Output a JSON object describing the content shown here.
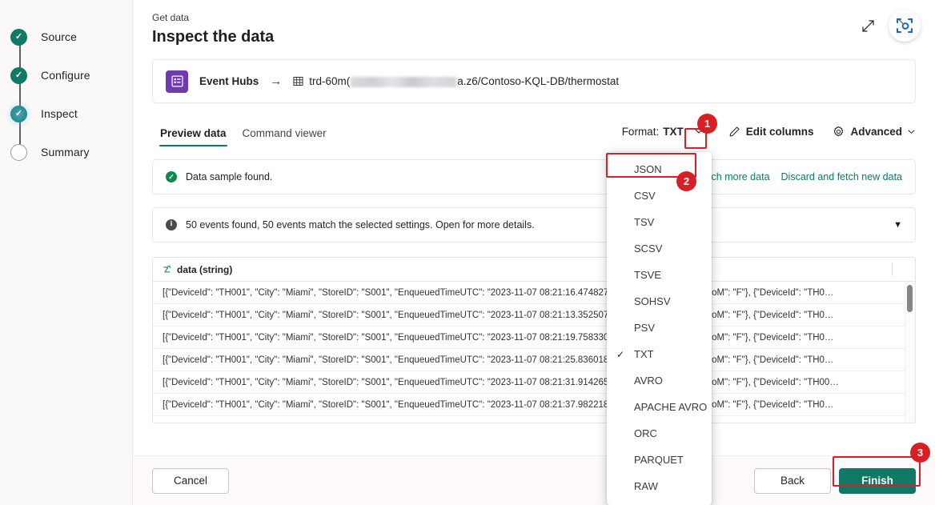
{
  "sidebar": {
    "steps": [
      {
        "label": "Source",
        "state": "done"
      },
      {
        "label": "Configure",
        "state": "done"
      },
      {
        "label": "Inspect",
        "state": "current"
      },
      {
        "label": "Summary",
        "state": "pending"
      }
    ]
  },
  "header": {
    "eyebrow": "Get data",
    "title": "Inspect the data",
    "expand_icon": "expand-diagonal-icon",
    "capture_icon": "focus-capture-icon"
  },
  "source_card": {
    "icon": "event-hubs-icon",
    "source_name": "Event Hubs",
    "arrow": "→",
    "target_icon": "table-grid-icon",
    "target_prefix": "trd-60m(",
    "target_redacted": true,
    "target_suffix": "a.z6/Contoso-KQL-DB/thermostat"
  },
  "tabs": [
    {
      "label": "Preview data",
      "active": true
    },
    {
      "label": "Command viewer",
      "active": false
    }
  ],
  "toolbar": {
    "format_label": "Format:",
    "format_value": "TXT",
    "format_chevron": "chevron-down-icon",
    "edit_columns_icon": "pencil-icon",
    "edit_columns_label": "Edit columns",
    "advanced_icon": "gear-icon",
    "advanced_label": "Advanced",
    "advanced_chevron": "chevron-down-icon"
  },
  "format_menu": {
    "options": [
      {
        "label": "JSON",
        "checked": false
      },
      {
        "label": "CSV",
        "checked": false
      },
      {
        "label": "TSV",
        "checked": false
      },
      {
        "label": "SCSV",
        "checked": false
      },
      {
        "label": "TSVE",
        "checked": false
      },
      {
        "label": "SOHSV",
        "checked": false
      },
      {
        "label": "PSV",
        "checked": false
      },
      {
        "label": "TXT",
        "checked": true
      },
      {
        "label": "AVRO",
        "checked": false
      },
      {
        "label": "APACHE AVRO",
        "checked": false
      },
      {
        "label": "ORC",
        "checked": false
      },
      {
        "label": "PARQUET",
        "checked": false
      },
      {
        "label": "RAW",
        "checked": false
      }
    ],
    "check_glyph": "✓"
  },
  "messages": {
    "success": {
      "icon": "success-check-icon",
      "text": "Data sample found.",
      "links": [
        {
          "label": "Fetch more data"
        },
        {
          "label": "Discard and fetch new data"
        }
      ]
    },
    "info": {
      "icon": "info-icon",
      "text": "50 events found, 50 events match the selected settings. Open for more details.",
      "expand_icon": "caret-down-icon"
    }
  },
  "grid": {
    "column": {
      "type_icon": "string-type-icon",
      "header": "data (string)"
    },
    "rows": [
      "[{\"DeviceId\": \"TH001\", \"City\": \"Miami\", \"StoreID\": \"S001\", \"EnqueuedTimeUTC\": \"2023-11-07 08:21:16.474827\", \"Temp\": 71.4, \"Temp_UoM\": \"F\"}, {\"DeviceId\": \"TH0…",
      "[{\"DeviceId\": \"TH001\", \"City\": \"Miami\", \"StoreID\": \"S001\", \"EnqueuedTimeUTC\": \"2023-11-07 08:21:13.352507\", \"Temp\": 68.6, \"Temp_UoM\": \"F\"}, {\"DeviceId\": \"TH0…",
      "[{\"DeviceId\": \"TH001\", \"City\": \"Miami\", \"StoreID\": \"S001\", \"EnqueuedTimeUTC\": \"2023-11-07 08:21:19.758330\", \"Temp\": 68.1, \"Temp_UoM\": \"F\"}, {\"DeviceId\": \"TH0…",
      "[{\"DeviceId\": \"TH001\", \"City\": \"Miami\", \"StoreID\": \"S001\", \"EnqueuedTimeUTC\": \"2023-11-07 08:21:25.836018\", \"Temp\": 61.3, \"Temp_UoM\": \"F\"}, {\"DeviceId\": \"TH0…",
      "[{\"DeviceId\": \"TH001\", \"City\": \"Miami\", \"StoreID\": \"S001\", \"EnqueuedTimeUTC\": \"2023-11-07 08:21:31.914265\", \"Temp\": 62.0, \"Temp_UoM\": \"F\"}, {\"DeviceId\": \"TH00…",
      "[{\"DeviceId\": \"TH001\", \"City\": \"Miami\", \"StoreID\": \"S001\", \"EnqueuedTimeUTC\": \"2023-11-07 08:21:37.982218\", \"Temp\": 62.7, \"Temp_UoM\": \"F\"}, {\"DeviceId\": \"TH0…"
    ]
  },
  "footer": {
    "cancel_label": "Cancel",
    "back_label": "Back",
    "finish_label": "Finish"
  },
  "annotations": [
    {
      "badge": "1"
    },
    {
      "badge": "2"
    },
    {
      "badge": "3"
    }
  ],
  "colors": {
    "accent_teal": "#0e7a64",
    "primary_button": "#117865",
    "annotation_red": "#d91f26",
    "event_hubs_purple": "#6f3ab1",
    "capture_blue": "#1567c8"
  }
}
